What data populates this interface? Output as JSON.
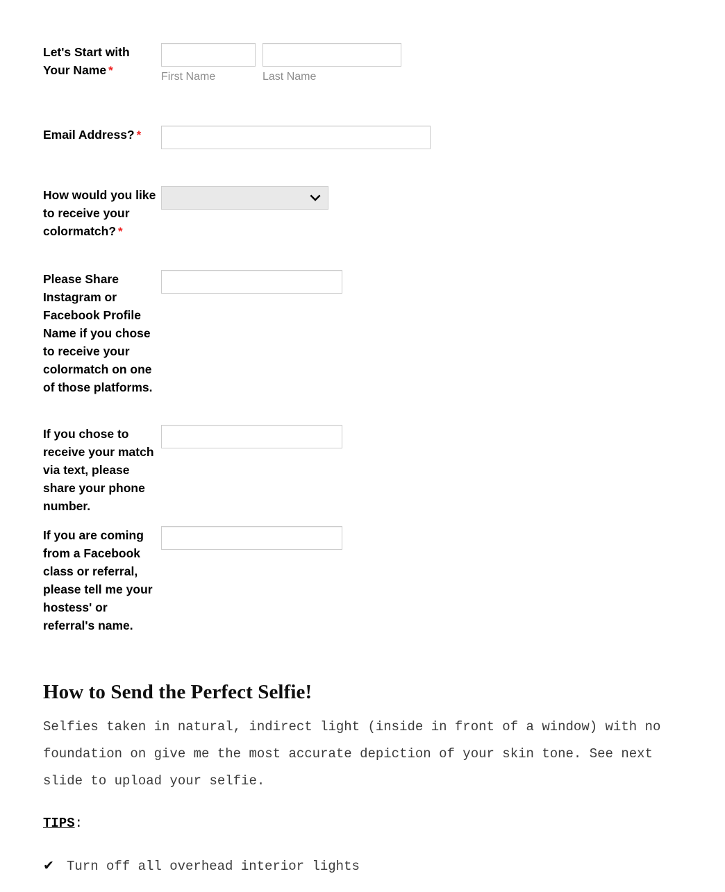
{
  "form": {
    "required_marker": "*",
    "fields": [
      {
        "id": "name",
        "label": "Let's Start with Your Name",
        "required": true,
        "type": "name-pair",
        "first_name": {
          "value": "",
          "placeholder": "",
          "sub_label": "First Name"
        },
        "last_name": {
          "value": "",
          "placeholder": "",
          "sub_label": "Last Name"
        }
      },
      {
        "id": "email",
        "label": "Email Address?",
        "required": true,
        "type": "text",
        "value": "",
        "placeholder": ""
      },
      {
        "id": "delivery-method",
        "label": "How would you like to receive your colormatch?",
        "required": true,
        "type": "select",
        "selected": "",
        "options": []
      },
      {
        "id": "social-profile",
        "label": "Please Share Instagram or Facebook Profile Name if you chose to receive your colormatch on one of those platforms.",
        "required": false,
        "type": "text",
        "value": "",
        "placeholder": ""
      },
      {
        "id": "phone-number",
        "label": "If you chose to receive your match via text, please share your phone number.",
        "required": false,
        "type": "text",
        "value": "",
        "placeholder": ""
      },
      {
        "id": "referral-name",
        "label": "If you are coming from a Facebook class or referral, please tell me your hostess' or referral's name.",
        "required": false,
        "type": "text",
        "value": "",
        "placeholder": ""
      }
    ]
  },
  "selfie": {
    "heading": "How to Send the Perfect Selfie!",
    "body": "Selfies taken in natural, indirect light (inside in front of a window) with no foundation on give me the most accurate depiction of your skin tone. See next slide to upload your selfie.",
    "tips_word": "TIPS",
    "tips_colon": ":",
    "tips": [
      {
        "check": "✔",
        "text": "Turn off all overhead interior lights"
      }
    ]
  },
  "colors": {
    "required_star": "#ee2222",
    "input_border": "#cccccc",
    "select_background": "#e9e9e9",
    "placeholder_text": "#8d8d8d",
    "body_text": "#3b3b3b"
  }
}
